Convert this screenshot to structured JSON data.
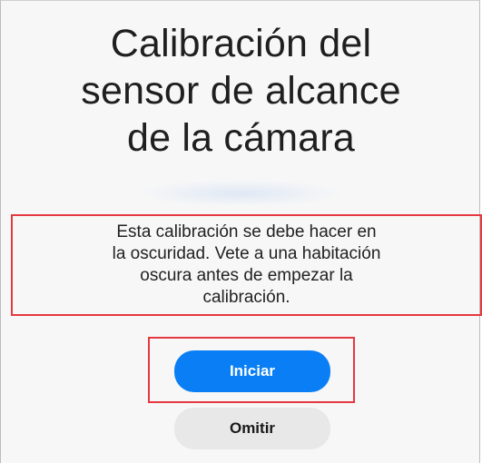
{
  "title_lines": [
    "Calibración del",
    "sensor de alcance",
    "de la cámara"
  ],
  "message_lines": [
    "Esta calibración se debe hacer en",
    "la oscuridad. Vete a una habitación",
    "oscura antes de empezar la",
    "calibración."
  ],
  "buttons": {
    "start_label": "Iniciar",
    "skip_label": "Omitir"
  },
  "colors": {
    "primary": "#0a7ff5",
    "secondary": "#e8e8e8",
    "highlight": "#e53941"
  }
}
